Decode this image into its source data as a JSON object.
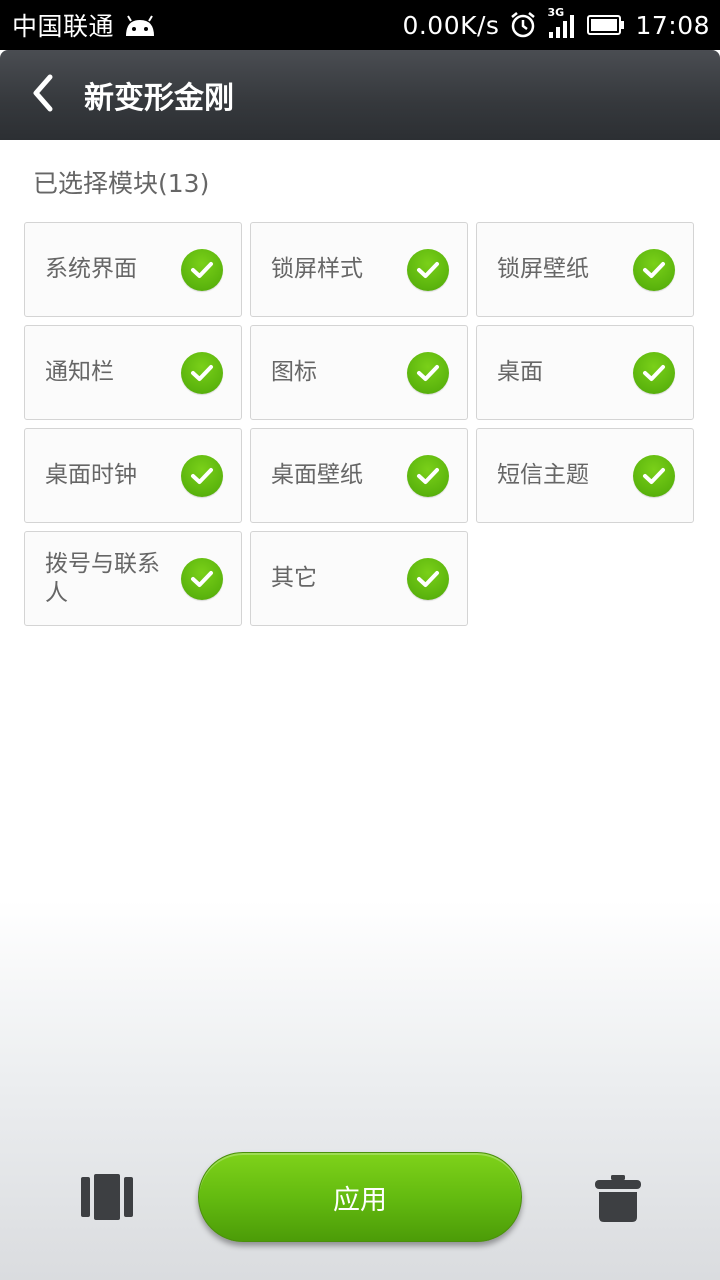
{
  "status_bar": {
    "carrier": "中国联通",
    "speed": "0.00K/s",
    "network": "3G",
    "time": "17:08"
  },
  "header": {
    "title": "新变形金刚"
  },
  "section": {
    "label": "已选择模块(13)"
  },
  "modules": [
    {
      "label": "系统界面",
      "checked": true
    },
    {
      "label": "锁屏样式",
      "checked": true
    },
    {
      "label": "锁屏壁纸",
      "checked": true
    },
    {
      "label": "通知栏",
      "checked": true
    },
    {
      "label": "图标",
      "checked": true
    },
    {
      "label": "桌面",
      "checked": true
    },
    {
      "label": "桌面时钟",
      "checked": true
    },
    {
      "label": "桌面壁纸",
      "checked": true
    },
    {
      "label": "短信主题",
      "checked": true
    },
    {
      "label": "拨号与联系人",
      "checked": true
    },
    {
      "label": "其它",
      "checked": true
    }
  ],
  "bottom": {
    "apply_label": "应用",
    "left_icon": "preview-icon",
    "right_icon": "trash-icon"
  },
  "colors": {
    "accent_green": "#5bb40d",
    "title_bar": "#35383c"
  }
}
